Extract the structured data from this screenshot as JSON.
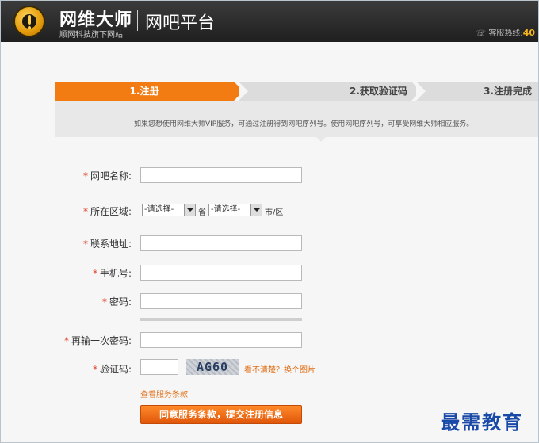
{
  "header": {
    "brand": "网维大师",
    "brand_sub": "顺网科技旗下网站",
    "platform": "网吧平台",
    "hotline_label": "客服热线:",
    "hotline_number": "40"
  },
  "steps": [
    {
      "label": "1.注册",
      "state": "active"
    },
    {
      "label": "2.获取验证码",
      "state": "pending"
    },
    {
      "label": "3.注册完成",
      "state": "pending"
    }
  ],
  "info": {
    "text": "如果您想使用网维大师VIP服务，可通过注册得到网吧序列号。使用网吧序列号，可享受网维大师相应服务。"
  },
  "form": {
    "required_mark": "*",
    "cafe_name_label": "网吧名称:",
    "cafe_name_value": "",
    "region_label": "所在区域:",
    "province_select": "-请选择-",
    "province_suffix": "省",
    "city_select": "-请选择-",
    "city_suffix": "市/区",
    "address_label": "联系地址:",
    "address_value": "",
    "phone_label": "手机号:",
    "phone_value": "",
    "password_label": "密码:",
    "password_value": "",
    "confirm_label": "再输一次密码:",
    "confirm_value": "",
    "captcha_label": "验证码:",
    "captcha_value": "",
    "captcha_image_text": "AG60",
    "refresh_link": "看不清楚？换个图片",
    "terms_link": "查看服务条款",
    "submit_label": "同意服务条款，提交注册信息"
  },
  "watermark": "最需教育",
  "colors": {
    "accent": "#f27b12",
    "required": "#e03a1e",
    "link": "#e06d14"
  }
}
